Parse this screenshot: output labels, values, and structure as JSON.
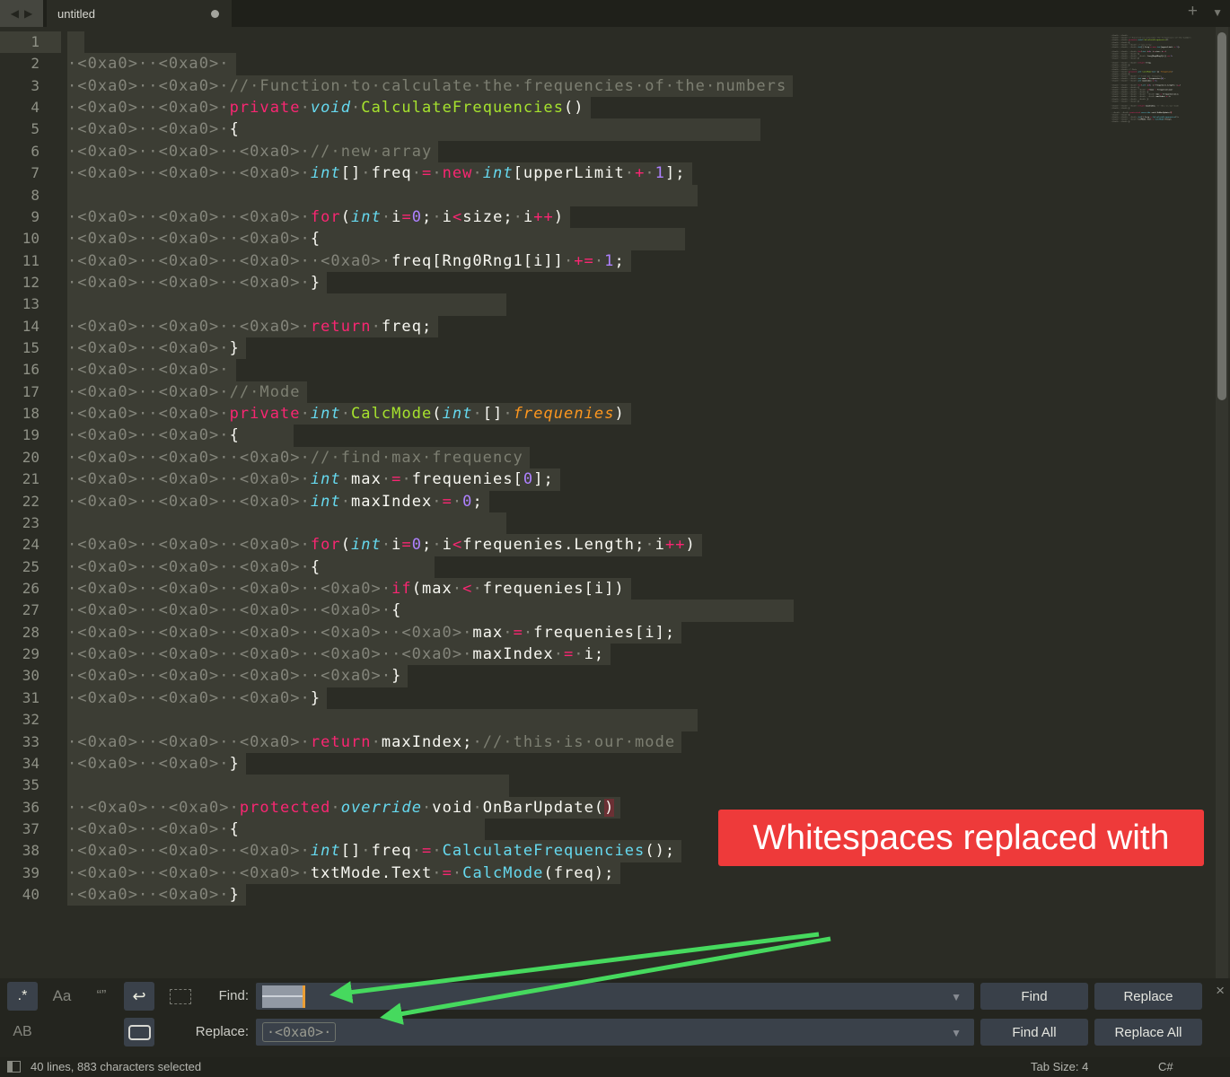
{
  "tab_bar": {
    "title": "untitled",
    "icons": {
      "back_arrow": "◀",
      "forward_arrow": "▶",
      "new_tab": "+",
      "tab_overflow": "▼",
      "modified_dot": "●"
    }
  },
  "banner": {
    "text": "Whitespaces replaced with",
    "bg": "#ee3a3a"
  },
  "colors": {
    "selection": "#3c3d34",
    "caret_orange": "#eb9e34",
    "arrow_green": "#46d95e",
    "banner_red": "#ee3a3a"
  },
  "find_panel": {
    "find_label": "Find:",
    "replace_label": "Replace:",
    "replace_value": "·<0xa0>·",
    "find_button": "Find",
    "replace_button": "Replace",
    "find_all_button": "Find All",
    "replace_all_button": "Replace All",
    "icons": {
      "regex": ".*",
      "case_sensitive": "Aa",
      "quotes": "“”",
      "wrap": "↩",
      "whole_word": "AB",
      "dropdown": "▼",
      "close": "×"
    }
  },
  "status_bar": {
    "selection_info": "40 lines, 883 characters selected",
    "tab_size": "Tab Size: 4",
    "syntax": "C#"
  },
  "editor": {
    "lines": [
      {
        "n": 1,
        "seg": [],
        "band": 12
      },
      {
        "n": 2,
        "seg": [
          [
            "ws",
            "·<0xa0>··<0xa0>·"
          ]
        ]
      },
      {
        "n": 3,
        "seg": [
          [
            "ws",
            "·<0xa0>··<0xa0>·"
          ],
          [
            "cm",
            "//·Function·to·calculate·the·frequencies·of·the·numbers"
          ]
        ]
      },
      {
        "n": 4,
        "seg": [
          [
            "ws",
            "·<0xa0>··<0xa0>·"
          ],
          [
            "kw",
            "private"
          ],
          [
            "ws",
            "·"
          ],
          [
            "ty",
            "void"
          ],
          [
            "ws",
            "·"
          ],
          [
            "fn",
            "CalculateFrequencies"
          ],
          [
            "tx",
            "()"
          ]
        ]
      },
      {
        "n": 5,
        "seg": [
          [
            "ws",
            "·<0xa0>··<0xa0>·"
          ],
          [
            "tx",
            "{"
          ]
        ],
        "band": 765
      },
      {
        "n": 6,
        "seg": [
          [
            "ws",
            "·<0xa0>··<0xa0>··<0xa0>·"
          ],
          [
            "cm",
            "//·new·array"
          ]
        ]
      },
      {
        "n": 7,
        "seg": [
          [
            "ws",
            "·<0xa0>··<0xa0>··<0xa0>·"
          ],
          [
            "ty",
            "int"
          ],
          [
            "tx",
            "[]"
          ],
          [
            "ws",
            "·"
          ],
          [
            "tx",
            "freq"
          ],
          [
            "ws",
            "·"
          ],
          [
            "kw",
            "="
          ],
          [
            "ws",
            "·"
          ],
          [
            "kw",
            "new"
          ],
          [
            "ws",
            "·"
          ],
          [
            "ty",
            "int"
          ],
          [
            "tx",
            "[upperLimit"
          ],
          [
            "ws",
            "·"
          ],
          [
            "kw",
            "+"
          ],
          [
            "ws",
            "·"
          ],
          [
            "nu",
            "1"
          ],
          [
            "tx",
            "];"
          ]
        ]
      },
      {
        "n": 8,
        "seg": [],
        "band": 695
      },
      {
        "n": 9,
        "seg": [
          [
            "ws",
            "·<0xa0>··<0xa0>··<0xa0>·"
          ],
          [
            "kw",
            "for"
          ],
          [
            "tx",
            "("
          ],
          [
            "ty",
            "int"
          ],
          [
            "ws",
            "·"
          ],
          [
            "tx",
            "i"
          ],
          [
            "kw",
            "="
          ],
          [
            "nu",
            "0"
          ],
          [
            "tx",
            ";"
          ],
          [
            "ws",
            "·"
          ],
          [
            "tx",
            "i"
          ],
          [
            "kw",
            "<"
          ],
          [
            "tx",
            "size;"
          ],
          [
            "ws",
            "·"
          ],
          [
            "tx",
            "i"
          ],
          [
            "kw",
            "++"
          ],
          [
            "tx",
            ")"
          ]
        ]
      },
      {
        "n": 10,
        "seg": [
          [
            "ws",
            "·<0xa0>··<0xa0>··<0xa0>·"
          ],
          [
            "tx",
            "{"
          ]
        ],
        "band": 681
      },
      {
        "n": 11,
        "seg": [
          [
            "ws",
            "·<0xa0>··<0xa0>··<0xa0>··<0xa0>·"
          ],
          [
            "tx",
            "freq[Rng0Rng1[i]]"
          ],
          [
            "ws",
            "·"
          ],
          [
            "kw",
            "+="
          ],
          [
            "ws",
            "·"
          ],
          [
            "nu",
            "1"
          ],
          [
            "tx",
            ";"
          ]
        ]
      },
      {
        "n": 12,
        "seg": [
          [
            "ws",
            "·<0xa0>··<0xa0>··<0xa0>·"
          ],
          [
            "tx",
            "}"
          ]
        ]
      },
      {
        "n": 13,
        "seg": [],
        "band": 482
      },
      {
        "n": 14,
        "seg": [
          [
            "ws",
            "·<0xa0>··<0xa0>··<0xa0>·"
          ],
          [
            "kw",
            "return"
          ],
          [
            "ws",
            "·"
          ],
          [
            "tx",
            "freq;"
          ]
        ]
      },
      {
        "n": 15,
        "seg": [
          [
            "ws",
            "·<0xa0>··<0xa0>·"
          ],
          [
            "tx",
            "}"
          ]
        ]
      },
      {
        "n": 16,
        "seg": [
          [
            "ws",
            "·<0xa0>··<0xa0>·"
          ]
        ]
      },
      {
        "n": 17,
        "seg": [
          [
            "ws",
            "·<0xa0>··<0xa0>·"
          ],
          [
            "cm",
            "//·Mode"
          ]
        ]
      },
      {
        "n": 18,
        "seg": [
          [
            "ws",
            "·<0xa0>··<0xa0>·"
          ],
          [
            "kw",
            "private"
          ],
          [
            "ws",
            "·"
          ],
          [
            "ty",
            "int"
          ],
          [
            "ws",
            "·"
          ],
          [
            "fn",
            "CalcMode"
          ],
          [
            "tx",
            "("
          ],
          [
            "ty",
            "int"
          ],
          [
            "ws",
            "·"
          ],
          [
            "tx",
            "[]"
          ],
          [
            "ws",
            "·"
          ],
          [
            "pr",
            "frequenies"
          ],
          [
            "tx",
            ")"
          ]
        ]
      },
      {
        "n": 19,
        "seg": [
          [
            "ws",
            "·<0xa0>··<0xa0>·"
          ],
          [
            "tx",
            "{"
          ]
        ],
        "band": 245
      },
      {
        "n": 20,
        "seg": [
          [
            "ws",
            "·<0xa0>··<0xa0>··<0xa0>·"
          ],
          [
            "cm",
            "//·find·max·frequency"
          ]
        ]
      },
      {
        "n": 21,
        "seg": [
          [
            "ws",
            "·<0xa0>··<0xa0>··<0xa0>·"
          ],
          [
            "ty",
            "int"
          ],
          [
            "ws",
            "·"
          ],
          [
            "tx",
            "max"
          ],
          [
            "ws",
            "·"
          ],
          [
            "kw",
            "="
          ],
          [
            "ws",
            "·"
          ],
          [
            "tx",
            "frequenies["
          ],
          [
            "nu",
            "0"
          ],
          [
            "tx",
            "];"
          ]
        ]
      },
      {
        "n": 22,
        "seg": [
          [
            "ws",
            "·<0xa0>··<0xa0>··<0xa0>·"
          ],
          [
            "ty",
            "int"
          ],
          [
            "ws",
            "·"
          ],
          [
            "tx",
            "maxIndex"
          ],
          [
            "ws",
            "·"
          ],
          [
            "kw",
            "="
          ],
          [
            "ws",
            "·"
          ],
          [
            "nu",
            "0"
          ],
          [
            "tx",
            ";"
          ]
        ]
      },
      {
        "n": 23,
        "seg": [],
        "band": 482
      },
      {
        "n": 24,
        "seg": [
          [
            "ws",
            "·<0xa0>··<0xa0>··<0xa0>·"
          ],
          [
            "kw",
            "for"
          ],
          [
            "tx",
            "("
          ],
          [
            "ty",
            "int"
          ],
          [
            "ws",
            "·"
          ],
          [
            "tx",
            "i"
          ],
          [
            "kw",
            "="
          ],
          [
            "nu",
            "0"
          ],
          [
            "tx",
            ";"
          ],
          [
            "ws",
            "·"
          ],
          [
            "tx",
            "i"
          ],
          [
            "kw",
            "<"
          ],
          [
            "tx",
            "frequenies.Length;"
          ],
          [
            "ws",
            "·"
          ],
          [
            "tx",
            "i"
          ],
          [
            "kw",
            "++"
          ],
          [
            "tx",
            ")"
          ]
        ]
      },
      {
        "n": 25,
        "seg": [
          [
            "ws",
            "·<0xa0>··<0xa0>··<0xa0>·"
          ],
          [
            "tx",
            "{"
          ]
        ],
        "band": 402
      },
      {
        "n": 26,
        "seg": [
          [
            "ws",
            "·<0xa0>··<0xa0>··<0xa0>··<0xa0>·"
          ],
          [
            "kw",
            "if"
          ],
          [
            "tx",
            "(max"
          ],
          [
            "ws",
            "·"
          ],
          [
            "kw",
            "<"
          ],
          [
            "ws",
            "·"
          ],
          [
            "tx",
            "frequenies[i])"
          ]
        ]
      },
      {
        "n": 27,
        "seg": [
          [
            "ws",
            "·<0xa0>··<0xa0>··<0xa0>··<0xa0>·"
          ],
          [
            "tx",
            "{"
          ]
        ],
        "band": 802
      },
      {
        "n": 28,
        "seg": [
          [
            "ws",
            "·<0xa0>··<0xa0>··<0xa0>··<0xa0>··<0xa0>·"
          ],
          [
            "tx",
            "max"
          ],
          [
            "ws",
            "·"
          ],
          [
            "kw",
            "="
          ],
          [
            "ws",
            "·"
          ],
          [
            "tx",
            "frequenies[i];"
          ]
        ]
      },
      {
        "n": 29,
        "seg": [
          [
            "ws",
            "·<0xa0>··<0xa0>··<0xa0>··<0xa0>··<0xa0>·"
          ],
          [
            "tx",
            "maxIndex"
          ],
          [
            "ws",
            "·"
          ],
          [
            "kw",
            "="
          ],
          [
            "ws",
            "·"
          ],
          [
            "tx",
            "i;"
          ]
        ]
      },
      {
        "n": 30,
        "seg": [
          [
            "ws",
            "·<0xa0>··<0xa0>··<0xa0>··<0xa0>·"
          ],
          [
            "tx",
            "}"
          ]
        ]
      },
      {
        "n": 31,
        "seg": [
          [
            "ws",
            "·<0xa0>··<0xa0>··<0xa0>·"
          ],
          [
            "tx",
            "}"
          ]
        ]
      },
      {
        "n": 32,
        "seg": [],
        "band": 695
      },
      {
        "n": 33,
        "seg": [
          [
            "ws",
            "·<0xa0>··<0xa0>··<0xa0>·"
          ],
          [
            "kw",
            "return"
          ],
          [
            "ws",
            "·"
          ],
          [
            "tx",
            "maxIndex;"
          ],
          [
            "ws",
            "·"
          ],
          [
            "cm",
            "//·this·is·our·mode"
          ]
        ]
      },
      {
        "n": 34,
        "seg": [
          [
            "ws",
            "·<0xa0>··<0xa0>·"
          ],
          [
            "tx",
            "}"
          ]
        ]
      },
      {
        "n": 35,
        "seg": [],
        "band": 485
      },
      {
        "n": 36,
        "seg": [
          [
            "ws",
            "··<0xa0>··<0xa0>·"
          ],
          [
            "kw",
            "protected"
          ],
          [
            "ws",
            "·"
          ],
          [
            "ty",
            "override"
          ],
          [
            "ws",
            "·"
          ],
          [
            "tx",
            "void"
          ],
          [
            "ws",
            "·"
          ],
          [
            "tx",
            "OnBarUpdate("
          ],
          [
            "bk",
            ")"
          ]
        ]
      },
      {
        "n": 37,
        "seg": [
          [
            "ws",
            "·<0xa0>··<0xa0>·"
          ],
          [
            "tx",
            "{"
          ]
        ],
        "band": 458
      },
      {
        "n": 38,
        "seg": [
          [
            "ws",
            "·<0xa0>··<0xa0>··<0xa0>·"
          ],
          [
            "ty",
            "int"
          ],
          [
            "tx",
            "[]"
          ],
          [
            "ws",
            "·"
          ],
          [
            "tx",
            "freq"
          ],
          [
            "ws",
            "·"
          ],
          [
            "kw",
            "="
          ],
          [
            "ws",
            "·"
          ],
          [
            "ca",
            "CalculateFrequencies"
          ],
          [
            "tx",
            "();"
          ]
        ]
      },
      {
        "n": 39,
        "seg": [
          [
            "ws",
            "·<0xa0>··<0xa0>··<0xa0>·"
          ],
          [
            "tx",
            "txtMode.Text"
          ],
          [
            "ws",
            "·"
          ],
          [
            "kw",
            "="
          ],
          [
            "ws",
            "·"
          ],
          [
            "ca",
            "CalcMode"
          ],
          [
            "tx",
            "(freq);"
          ]
        ]
      },
      {
        "n": 40,
        "seg": [
          [
            "ws",
            "·<0xa0>··<0xa0>·"
          ],
          [
            "tx",
            "}"
          ]
        ]
      }
    ]
  }
}
